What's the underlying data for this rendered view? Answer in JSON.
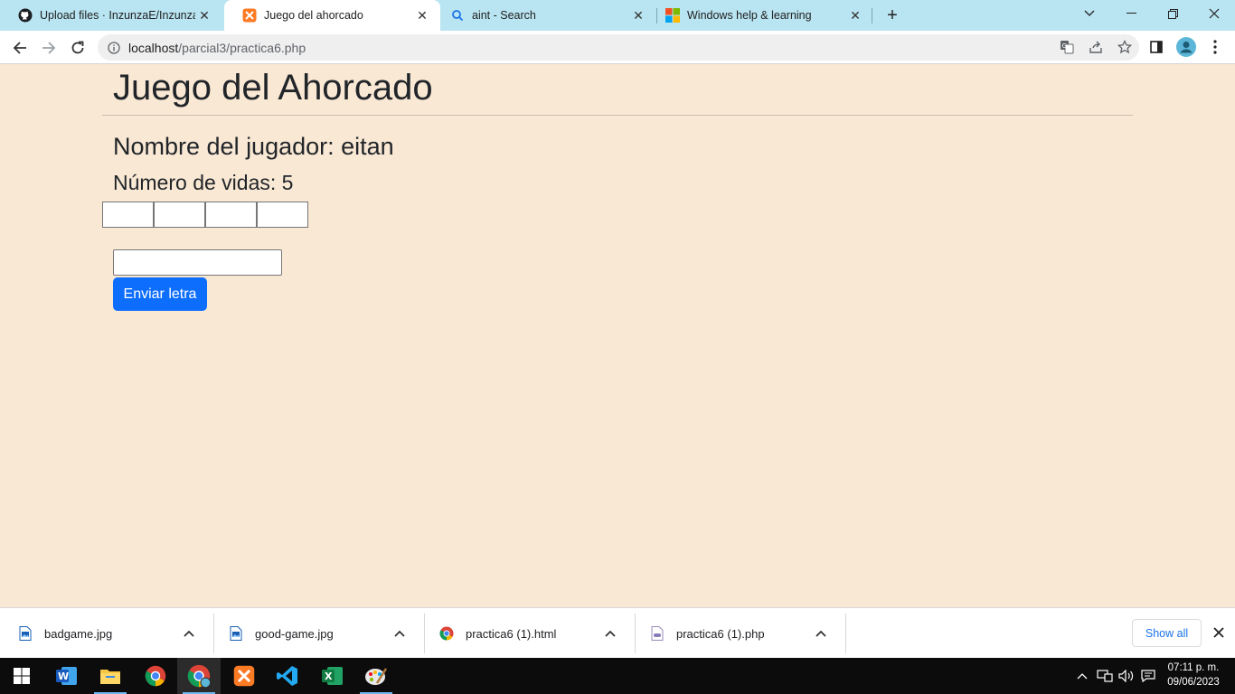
{
  "browser": {
    "tabs": [
      {
        "title": "Upload files · InzunzaE/InzunzaE",
        "icon": "github-icon",
        "active": false
      },
      {
        "title": "Juego del ahorcado",
        "icon": "xampp-icon",
        "active": true
      },
      {
        "title": "aint - Search",
        "icon": "search-icon",
        "active": false
      },
      {
        "title": "Windows help & learning",
        "icon": "windows-icon",
        "active": false
      }
    ],
    "url_host": "localhost",
    "url_path": "/parcial3/practica6.php"
  },
  "page": {
    "title": "Juego del Ahorcado",
    "player_label": "Nombre del jugador: eitan",
    "lives_label": "Número de vidas: 5",
    "letter_boxes": [
      "",
      "",
      "",
      ""
    ],
    "letter_input_value": "",
    "submit_label": "Enviar letra",
    "background_color": "#f9e8d4",
    "button_color": "#0d6efd"
  },
  "downloads": {
    "items": [
      {
        "name": "badgame.jpg",
        "icon": "image-file-icon"
      },
      {
        "name": "good-game.jpg",
        "icon": "image-file-icon"
      },
      {
        "name": "practica6 (1).html",
        "icon": "chrome-icon"
      },
      {
        "name": "practica6 (1).php",
        "icon": "php-file-icon"
      }
    ],
    "show_all_label": "Show all"
  },
  "taskbar": {
    "apps": [
      "word-icon",
      "file-explorer-icon",
      "chrome-icon",
      "chrome-profile-icon",
      "xampp-icon",
      "vscode-icon",
      "excel-icon",
      "paint-icon"
    ],
    "time": "07:11 p. m.",
    "date": "09/06/2023"
  }
}
